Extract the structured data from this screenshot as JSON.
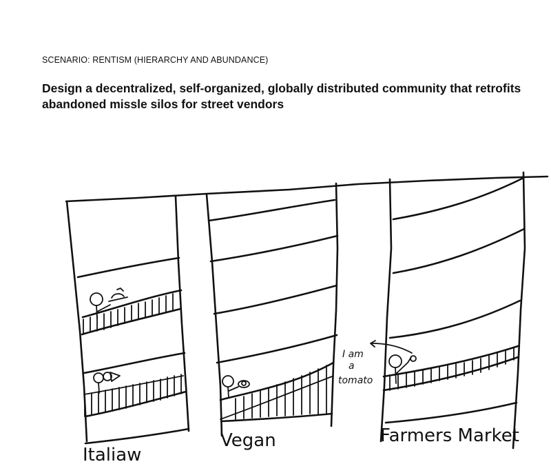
{
  "header": {
    "scenario": "SCENARIO: RENTISM (HIERARCHY AND ABUNDANCE)",
    "prompt": "Design a decentralized, self-organized, globally distributed community that retrofits abandoned missle silos for street vendors"
  },
  "sketch": {
    "silos": [
      {
        "label": "Italiaw"
      },
      {
        "label": "Vegan"
      },
      {
        "label": "Farmers Market"
      }
    ],
    "speech_bubble": [
      "I am",
      "a",
      "tomato"
    ]
  }
}
